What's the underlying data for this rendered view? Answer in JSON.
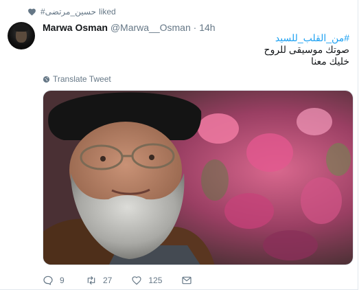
{
  "context": {
    "liker": "حسين_مرتضى#",
    "action": "liked"
  },
  "tweet": {
    "author_name": "Marwa Osman",
    "handle": "@Marwa__Osman",
    "separator": "·",
    "time": "14h",
    "hashtag": "#من_القلب_للسيد",
    "line1": "صوتك موسيقى للروح",
    "line2": "خليك معنا",
    "translate_label": "Translate Tweet"
  },
  "actions": {
    "replies": "9",
    "retweets": "27",
    "likes": "125"
  },
  "icons": {
    "context": "heart-icon",
    "translate": "globe-icon",
    "reply": "reply-icon",
    "retweet": "retweet-icon",
    "like": "like-icon",
    "message": "direct-message-icon"
  },
  "colors": {
    "link": "#1da1f2",
    "muted": "#657786",
    "text": "#14171a"
  }
}
